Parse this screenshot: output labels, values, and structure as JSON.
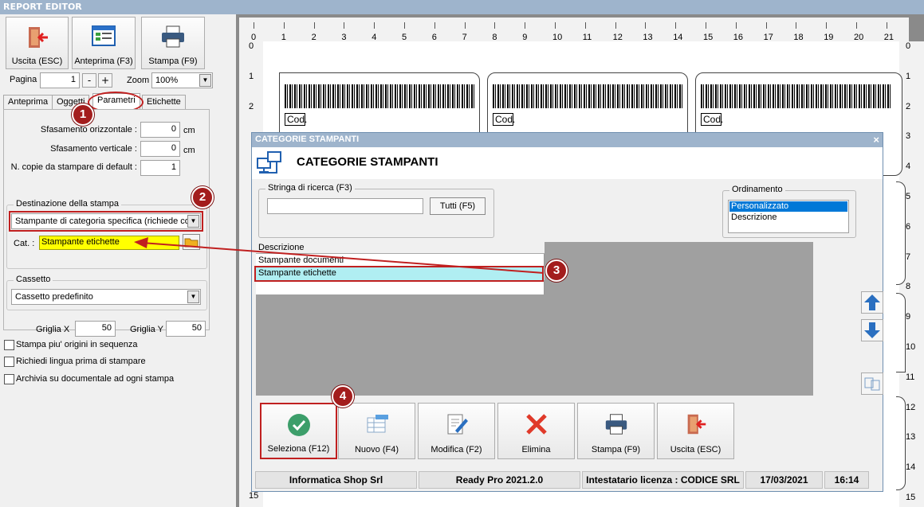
{
  "app": {
    "title": "REPORT EDITOR"
  },
  "toolbar": {
    "exit_label": "Uscita (ESC)",
    "preview_label": "Anteprima (F3)",
    "print_label": "Stampa (F9)"
  },
  "pager": {
    "page_label": "Pagina",
    "page_value": "1",
    "minus": "-",
    "plus": "+",
    "zoom_label": "Zoom",
    "zoom_value": "100%"
  },
  "tabs": [
    "Anteprima",
    "Oggetti",
    "Parametri",
    "Etichette"
  ],
  "params": {
    "h_offset_label": "Sfasamento orizzontale :",
    "h_offset_value": "0",
    "h_unit": "cm",
    "v_offset_label": "Sfasamento verticale :",
    "v_offset_value": "0",
    "v_unit": "cm",
    "copies_label": "N. copie da stampare di default :",
    "copies_value": "1",
    "dest_group": "Destinazione della stampa",
    "dest_value": "Stampante di categoria specifica (richiede co",
    "cat_label": "Cat. :",
    "cat_value": "Stampante etichette",
    "drawer_group": "Cassetto",
    "drawer_value": "Cassetto predefinito",
    "grid_x_label": "Griglia X",
    "grid_x_value": "50",
    "grid_y_label": "Griglia Y",
    "grid_y_value": "50"
  },
  "checks": [
    "Stampa piu' origini in sequenza",
    "Richiedi lingua prima di stampare",
    "Archivia su documentale ad ogni stampa"
  ],
  "markers": [
    "1",
    "2",
    "3",
    "4"
  ],
  "ruler": {
    "top": [
      "0",
      "1",
      "2",
      "3",
      "4",
      "5",
      "6",
      "7",
      "8",
      "9",
      "10",
      "11",
      "12",
      "13",
      "14",
      "15",
      "16",
      "17",
      "18",
      "19",
      "20",
      "21"
    ],
    "left": [
      "0",
      "1",
      "2"
    ],
    "left_bottom": [
      "15"
    ],
    "right": [
      "0",
      "1",
      "2",
      "3",
      "4",
      "5",
      "6",
      "7",
      "8",
      "9",
      "10",
      "11",
      "12",
      "13",
      "14",
      "15"
    ]
  },
  "labels": {
    "cod": "Cod."
  },
  "dialog": {
    "title": "CATEGORIE STAMPANTI",
    "close": "×",
    "heading": "CATEGORIE STAMPANTI",
    "search_group": "Stringa di ricerca (F3)",
    "search_value": "",
    "all_button": "Tutti (F5)",
    "order_group": "Ordinamento",
    "order_options": [
      "Personalizzato",
      "Descrizione"
    ],
    "list_header": "Descrizione",
    "rows": [
      "Stampante documenti",
      "Stampante etichette"
    ],
    "buttons": {
      "select": "Seleziona (F12)",
      "new": "Nuovo (F4)",
      "edit": "Modifica (F2)",
      "delete": "Elimina",
      "print": "Stampa (F9)",
      "exit": "Uscita (ESC)"
    },
    "status": {
      "company": "Informatica Shop Srl",
      "version": "Ready Pro 2021.2.0",
      "license": "Intestatario licenza : CODICE SRL",
      "date": "17/03/2021",
      "time": "16:14"
    }
  },
  "colors": {
    "accent_red": "#a31d1d",
    "title_bar": "#9eb4cc",
    "highlight_yellow": "#ffff00",
    "selected_row": "#b0eef2",
    "selected_option": "#0078d7"
  }
}
